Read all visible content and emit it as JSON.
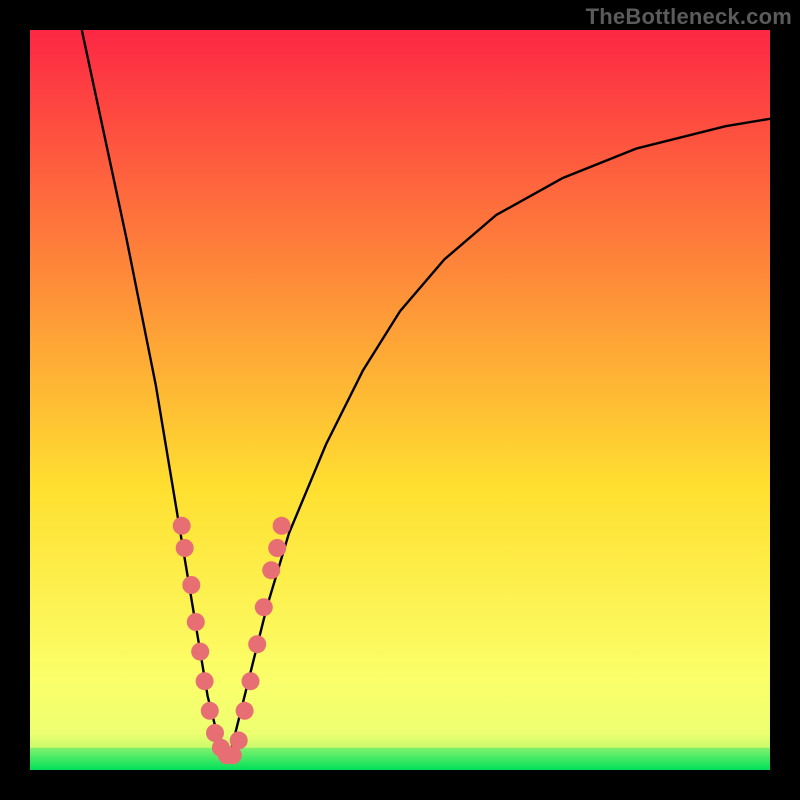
{
  "watermark": "TheBottleneck.com",
  "chart_data": {
    "type": "line",
    "title": "",
    "xlabel": "",
    "ylabel": "",
    "xlim": [
      0,
      100
    ],
    "ylim": [
      0,
      100
    ],
    "grid": false,
    "legend": false,
    "background_gradient": {
      "top": "#fd2744",
      "mid": "#ffe030",
      "accent_band": "#fbff6a",
      "bottom": "#00e05a"
    },
    "accent_band_y": [
      3,
      11
    ],
    "series": [
      {
        "name": "left-branch",
        "x": [
          7,
          10,
          13,
          15,
          17,
          19,
          20,
          21,
          22,
          23,
          24,
          25,
          26
        ],
        "y": [
          100,
          86,
          72,
          62,
          52,
          40,
          34,
          28,
          22,
          16,
          10,
          6,
          2
        ]
      },
      {
        "name": "right-branch",
        "x": [
          27,
          28,
          30,
          32,
          35,
          40,
          45,
          50,
          56,
          63,
          72,
          82,
          94,
          100
        ],
        "y": [
          2,
          6,
          14,
          22,
          32,
          44,
          54,
          62,
          69,
          75,
          80,
          84,
          87,
          88
        ]
      }
    ],
    "markers": {
      "name": "pink-dots",
      "color": "#e76f73",
      "radius": 9,
      "points": [
        {
          "x": 20.5,
          "y": 33
        },
        {
          "x": 20.9,
          "y": 30
        },
        {
          "x": 21.8,
          "y": 25
        },
        {
          "x": 22.4,
          "y": 20
        },
        {
          "x": 23.0,
          "y": 16
        },
        {
          "x": 23.6,
          "y": 12
        },
        {
          "x": 24.3,
          "y": 8
        },
        {
          "x": 25.0,
          "y": 5
        },
        {
          "x": 25.8,
          "y": 3
        },
        {
          "x": 26.6,
          "y": 2
        },
        {
          "x": 27.4,
          "y": 2
        },
        {
          "x": 28.2,
          "y": 4
        },
        {
          "x": 29.0,
          "y": 8
        },
        {
          "x": 29.8,
          "y": 12
        },
        {
          "x": 30.7,
          "y": 17
        },
        {
          "x": 31.6,
          "y": 22
        },
        {
          "x": 32.6,
          "y": 27
        },
        {
          "x": 33.4,
          "y": 30
        },
        {
          "x": 34.0,
          "y": 33
        }
      ]
    }
  }
}
